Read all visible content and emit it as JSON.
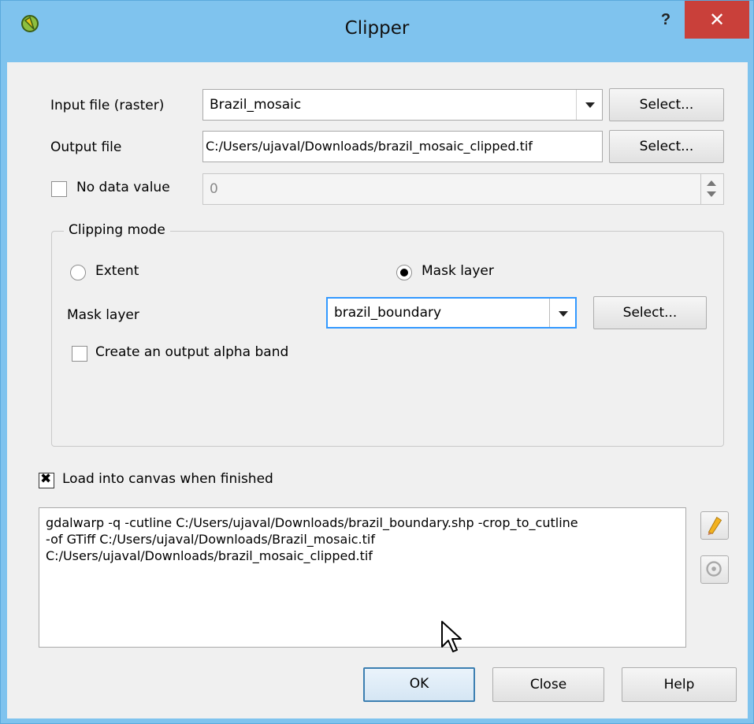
{
  "window": {
    "title": "Clipper",
    "help_label": "?",
    "close_label": "✕"
  },
  "input_file": {
    "label": "Input file (raster)",
    "value": "Brazil_mosaic",
    "button": "Select..."
  },
  "output_file": {
    "label": "Output file",
    "value": "C:/Users/ujaval/Downloads/brazil_mosaic_clipped.tif",
    "button": "Select..."
  },
  "nodata": {
    "label": "No data value",
    "checked": false,
    "value": "0"
  },
  "clipping": {
    "title": "Clipping mode",
    "extent_label": "Extent",
    "mask_radio_label": "Mask layer",
    "mask_label": "Mask layer",
    "mask_value": "brazil_boundary",
    "mask_button": "Select...",
    "alpha_label": "Create an output alpha band"
  },
  "load_canvas": {
    "label": "Load into canvas when finished",
    "checked": true
  },
  "command": {
    "lines": [
      "gdalwarp -q -cutline C:/Users/ujaval/Downloads/brazil_boundary.shp -crop_to_cutline",
      "-of GTiff C:/Users/ujaval/Downloads/Brazil_mosaic.tif",
      "C:/Users/ujaval/Downloads/brazil_mosaic_clipped.tif"
    ]
  },
  "buttons": {
    "ok": "OK",
    "close": "Close",
    "help": "Help"
  },
  "icons": {
    "app": "qgis-icon",
    "edit": "pencil-icon",
    "reset": "reset-icon"
  }
}
